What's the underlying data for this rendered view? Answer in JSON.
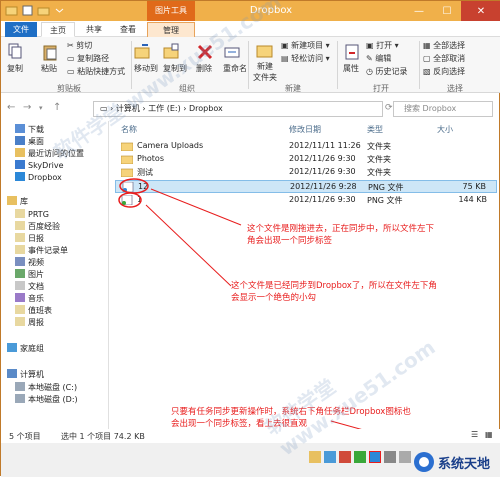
{
  "window": {
    "title": "Dropbox",
    "picture_tools": "图片工具"
  },
  "tabs": {
    "file": "文件",
    "home": "主页",
    "share": "共享",
    "view": "查看",
    "manage": "管理"
  },
  "ribbon": {
    "copy": "复制",
    "paste": "粘贴",
    "cut": "剪切",
    "copy_path": "复制路径",
    "paste_shortcut": "粘贴快捷方式",
    "move_to": "移动到",
    "copy_to": "复制到",
    "delete": "删除",
    "rename": "重命名",
    "new_folder": "新建\n文件夹",
    "new_folder_l1": "新建",
    "new_folder_l2": "文件夹",
    "new_item": "新建项目",
    "easy_access": "轻松访问",
    "properties": "属性",
    "open": "打开",
    "edit": "编辑",
    "history": "历史记录",
    "select_all": "全部选择",
    "select_none": "全部取消",
    "invert_selection": "反向选择",
    "groups": {
      "clipboard": "剪贴板",
      "organize": "组织",
      "new": "新建",
      "open": "打开",
      "select": "选择"
    }
  },
  "address": {
    "path_parts": [
      "计算机",
      "工作 (E:)",
      "Dropbox"
    ],
    "search_placeholder": "搜索 Dropbox"
  },
  "nav": {
    "items": [
      "下载",
      "桌面",
      "最近访问的位置",
      "SkyDrive",
      "Dropbox",
      "库",
      "PRTG",
      "百度经验",
      "日报",
      "事件记录单",
      "视频",
      "图片",
      "文档",
      "音乐",
      "值班表",
      "周报",
      "家庭组",
      "计算机",
      "本地磁盘 (C:)",
      "本地磁盘 (D:)"
    ]
  },
  "columns": {
    "name": "名称",
    "date": "修改日期",
    "type": "类型",
    "size": "大小"
  },
  "files": [
    {
      "name": "Camera Uploads",
      "date": "2012/11/11 11:26",
      "type": "文件夹",
      "size": ""
    },
    {
      "name": "Photos",
      "date": "2012/11/26 9:30",
      "type": "文件夹",
      "size": ""
    },
    {
      "name": "测试",
      "date": "2012/11/26 9:30",
      "type": "文件夹",
      "size": ""
    },
    {
      "name": "12",
      "date": "2012/11/26 9:28",
      "type": "PNG 文件",
      "size": "75 KB"
    },
    {
      "name": "1",
      "date": "2012/11/26 9:30",
      "type": "PNG 文件",
      "size": "144 KB"
    }
  ],
  "annotations": {
    "a1_l1": "这个文件是刚拖进去，正在同步中，所以文件左下",
    "a1_l2": "角会出现一个同步标签",
    "a2_l1": "这个文件是已经同步到Dropbox了，所以在文件左下角",
    "a2_l2": "会显示一个绝色的小勾",
    "a3_l1": "只要有任务同步更新操作时，系统右下角任务栏Dropbox图标也",
    "a3_l2": "会出现一个同步标签，看上去很直观"
  },
  "status": {
    "count": "5 个项目",
    "selected": "选中 1 个项目  74.2 KB"
  },
  "logo": {
    "text": "系统天地"
  },
  "watermark": {
    "text": "软件学堂 www.xue51.com"
  },
  "colors": {
    "title_bar": "#f0b04a",
    "file_tab": "#1f6fc5",
    "annotation": "#e81d1d",
    "selection": "#cde6f7"
  }
}
